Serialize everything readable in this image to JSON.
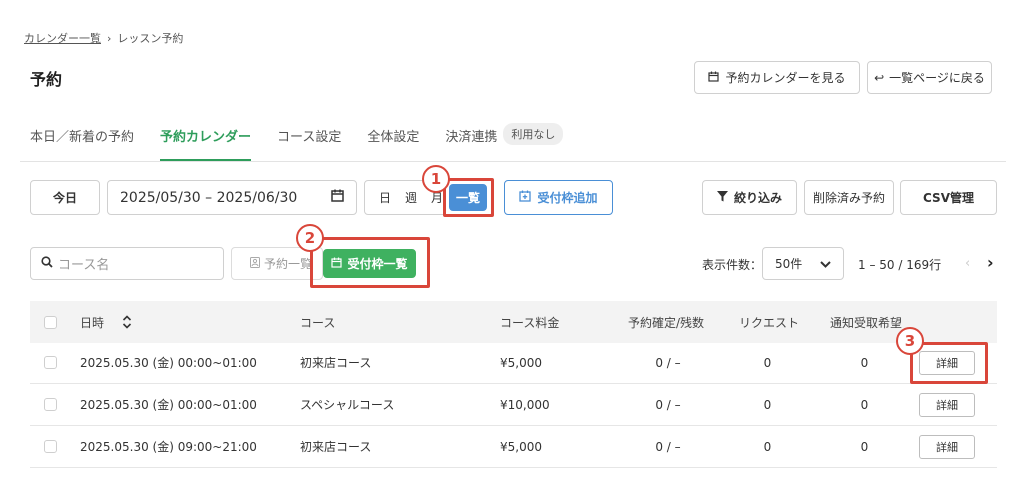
{
  "breadcrumb": {
    "parent": "カレンダー一覧",
    "separator": "›",
    "current": "レッスン予約"
  },
  "page_title": "予約",
  "header_buttons": {
    "view_calendar": "予約カレンダーを見る",
    "back_to_list": "一覧ページに戻る"
  },
  "tabs": [
    {
      "label": "本日／新着の予約"
    },
    {
      "label": "予約カレンダー"
    },
    {
      "label": "コース設定"
    },
    {
      "label": "全体設定"
    },
    {
      "label": "決済連携"
    }
  ],
  "payment_badge": "利用なし",
  "toolbar": {
    "today": "今日",
    "date_range": "2025/05/30 – 2025/06/30",
    "day": "日",
    "week": "週",
    "month": "月",
    "list": "一覧",
    "add_slot": "受付枠追加",
    "filter": "絞り込み",
    "deleted": "削除済み予約",
    "csv": "CSV管理"
  },
  "subbar": {
    "search_placeholder": "コース名",
    "reservation_list": "予約一覧",
    "slot_list": "受付枠一覧",
    "per_page_label": "表示件数：",
    "per_page_value": "50件",
    "pagination": "1 – 50 / 169行"
  },
  "table": {
    "headers": [
      "日時",
      "コース",
      "コース料金",
      "予約確定/残数",
      "リクエスト",
      "通知受取希望"
    ],
    "rows": [
      {
        "datetime": "2025.05.30 (金) 00:00~01:00",
        "course": "初来店コース",
        "price": "¥5,000",
        "confirmed": "0 / –",
        "request": "0",
        "notify": "0",
        "action": "詳細"
      },
      {
        "datetime": "2025.05.30 (金) 00:00~01:00",
        "course": "スペシャルコース",
        "price": "¥10,000",
        "confirmed": "0 / –",
        "request": "0",
        "notify": "0",
        "action": "詳細"
      },
      {
        "datetime": "2025.05.30 (金) 09:00~21:00",
        "course": "初来店コース",
        "price": "¥5,000",
        "confirmed": "0 / –",
        "request": "0",
        "notify": "0",
        "action": "詳細"
      }
    ]
  },
  "annotations": [
    "1",
    "2",
    "3"
  ],
  "colors": {
    "accent_green": "#2e9d5b",
    "button_green": "#3fb160",
    "button_blue": "#4a8fd6",
    "annotation_red": "#d9463a"
  }
}
